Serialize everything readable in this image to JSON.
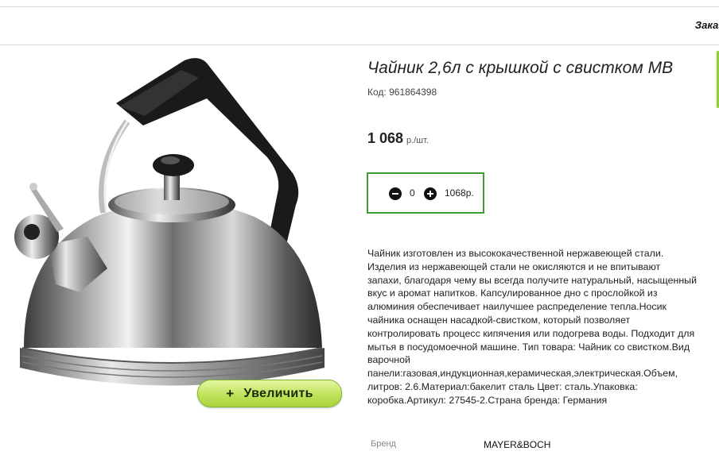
{
  "header": {
    "link_text": "Заказ"
  },
  "product": {
    "title": "Чайник 2,6л с крышкой с свистком МВ",
    "code_label": "Код:",
    "code_value": "961864398",
    "price_value": "1 068",
    "price_unit": "р./шт.",
    "zoom_button_label": "Увеличить",
    "zoom_button_icon": "plus",
    "image_icon": "kettle-photo"
  },
  "cart": {
    "quantity": "0",
    "sum": "1068р.",
    "minus_icon": "minus-circle-icon",
    "plus_icon": "plus-circle-icon",
    "border_color": "#3c9b33"
  },
  "description": "Чайник изготовлен из высококачественной нержавеющей стали.\nИзделия из нержавеющей стали не окисляются и не впитывают\nзапахи, благодаря чему вы всегда получите натуральный, насыщенный\nвкус и аромат напитков. Капсулированное дно с прослойкой из\nалюминия обеспечивает наилучшее распределение тепла.Носик\nчайника оснащен насадкой-свистком, который позволяет\nконтролировать процесс кипячения или подогрева воды. Подходит для\nмытья в посудомоечной машине. Тип товара: Чайник со свистком.Вид\nварочной\nпанели:газовая,индукционная,керамическая,электрическая.Объем,\nлитров: 2.6.Материал:бакелит сталь Цвет: сталь.Упаковка:\nкоробка.Артикул: 27545-2.Страна бренда: Германия",
  "specs": {
    "brand_label": "Бренд",
    "brand_value": "MAYER&BOCH"
  },
  "colors": {
    "accent_green": "#8fd42b",
    "button_green": "#bfe35a"
  }
}
